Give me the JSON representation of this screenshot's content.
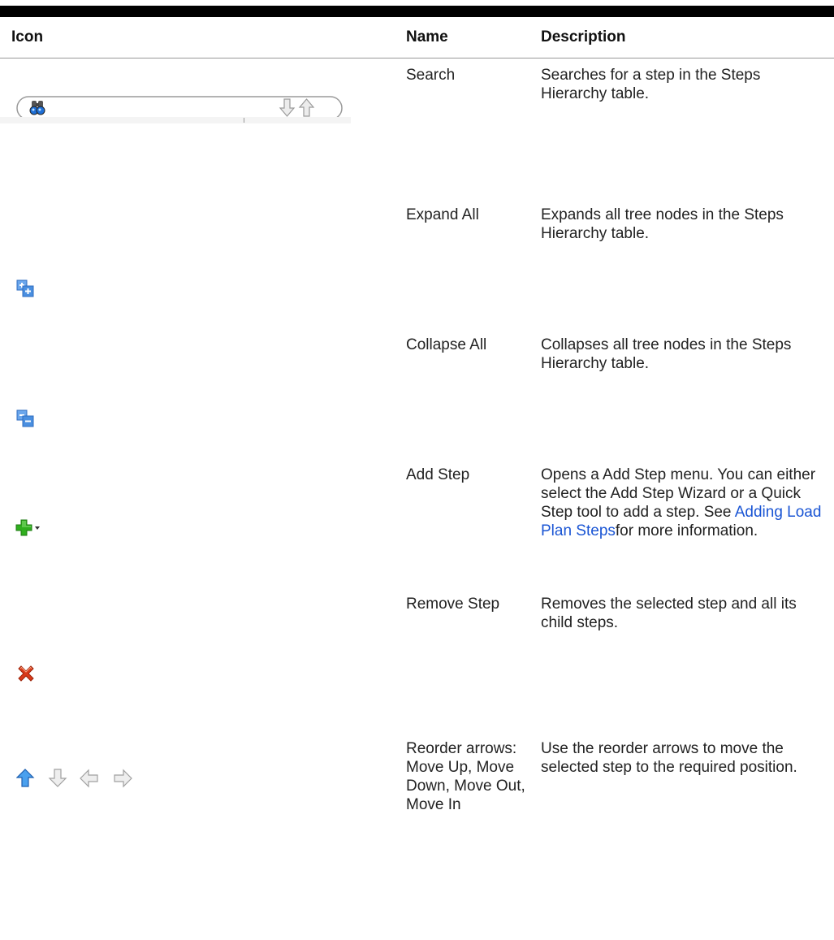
{
  "table": {
    "headers": {
      "icon": "Icon",
      "name": "Name",
      "description": "Description"
    },
    "rows": [
      {
        "icon": "search-field-icon",
        "name": "Search",
        "description": "Searches for a step in the Steps Hierarchy table."
      },
      {
        "icon": "expand-all-icon",
        "name": "Expand All",
        "description": "Expands all tree nodes in the Steps Hierarchy table."
      },
      {
        "icon": "collapse-all-icon",
        "name": "Collapse All",
        "description": "Collapses all tree nodes in the Steps Hierarchy table."
      },
      {
        "icon": "add-step-dropdown-icon",
        "name": "Add Step",
        "description_before": "Opens a Add Step menu. You can either select the Add Step Wizard or a Quick Step tool to add a step. See ",
        "description_link": "Adding Load Plan Steps",
        "description_after": "for more information."
      },
      {
        "icon": "remove-step-icon",
        "name": "Remove Step",
        "description": "Removes the selected step and all its child steps."
      },
      {
        "icon": "reorder-arrows-icon",
        "name": "Reorder arrows: Move Up, Move Down, Move Out, Move In",
        "description": "Use the reorder arrows to move the selected step to the required position."
      }
    ]
  },
  "colors": {
    "link": "#1a55d4",
    "add_green": "#2fae1e",
    "remove_red": "#d93a1a",
    "blue_icon": "#4a8fe0"
  }
}
